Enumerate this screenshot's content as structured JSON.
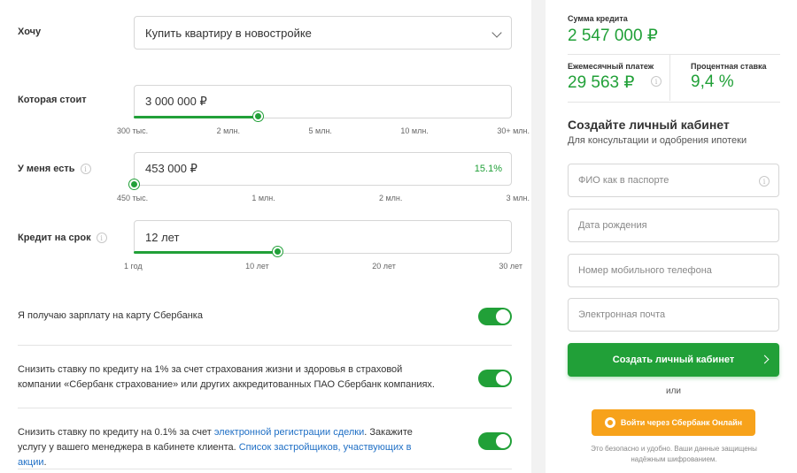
{
  "form": {
    "want_label": "Хочу",
    "want_value": "Купить квартиру в новостройке",
    "price_label": "Которая стоит",
    "price_value": "3 000 000 ₽",
    "price_ticks": [
      "300 тыс.",
      "2 млн.",
      "5 млн.",
      "10 млн.",
      "30+ млн."
    ],
    "have_label": "У меня есть",
    "have_value": "453 000 ₽",
    "have_percent": "15.1%",
    "have_ticks": [
      "450 тыс.",
      "1 млн.",
      "2 млн.",
      "3 млн."
    ],
    "term_label": "Кредит на срок",
    "term_value": "12 лет",
    "term_ticks": [
      "1 год",
      "10 лет",
      "20 лет",
      "30 лет"
    ]
  },
  "toggles": [
    {
      "text_parts": [
        "Я получаю зарплату на карту Сбербанка"
      ],
      "on": true
    },
    {
      "text_parts": [
        "Снизить ставку по кредиту на 1% за счет страхования жизни и здоровья в страховой компании «Сбербанк страхование» или других аккредитованных ПАО Сбербанк компаниях."
      ],
      "on": true
    },
    {
      "text_parts": [
        "Снизить ставку по кредиту на 0.1% за счет ",
        "электронной регистрации сделки",
        ". Закажите услугу у вашего менеджера в кабинете клиента. ",
        "Список застройщиков, участвующих в акции",
        "."
      ],
      "on": true
    }
  ],
  "summary": {
    "loan_label": "Сумма кредита",
    "loan_value": "2 547 000 ₽",
    "payment_label": "Ежемесячный платеж",
    "payment_value": "29 563 ₽",
    "rate_label": "Процентная ставка",
    "rate_value": "9,4 %"
  },
  "cabinet": {
    "title": "Создайте личный кабинет",
    "subtitle": "Для консультации и одобрения ипотеки",
    "fio_placeholder": "ФИО как в паспорте",
    "dob_placeholder": "Дата рождения",
    "phone_placeholder": "Номер мобильного телефона",
    "email_placeholder": "Электронная почта",
    "create_button": "Создать личный кабинет",
    "or_text": "или",
    "sbol_button": "Войти через Сбербанк Онлайн",
    "safe_note": "Это безопасно и удобно. Ваши данные защищены надёжным шифрованием."
  },
  "colors": {
    "accent": "#21a038",
    "orange": "#f7a21b",
    "link": "#1f6fc5"
  }
}
